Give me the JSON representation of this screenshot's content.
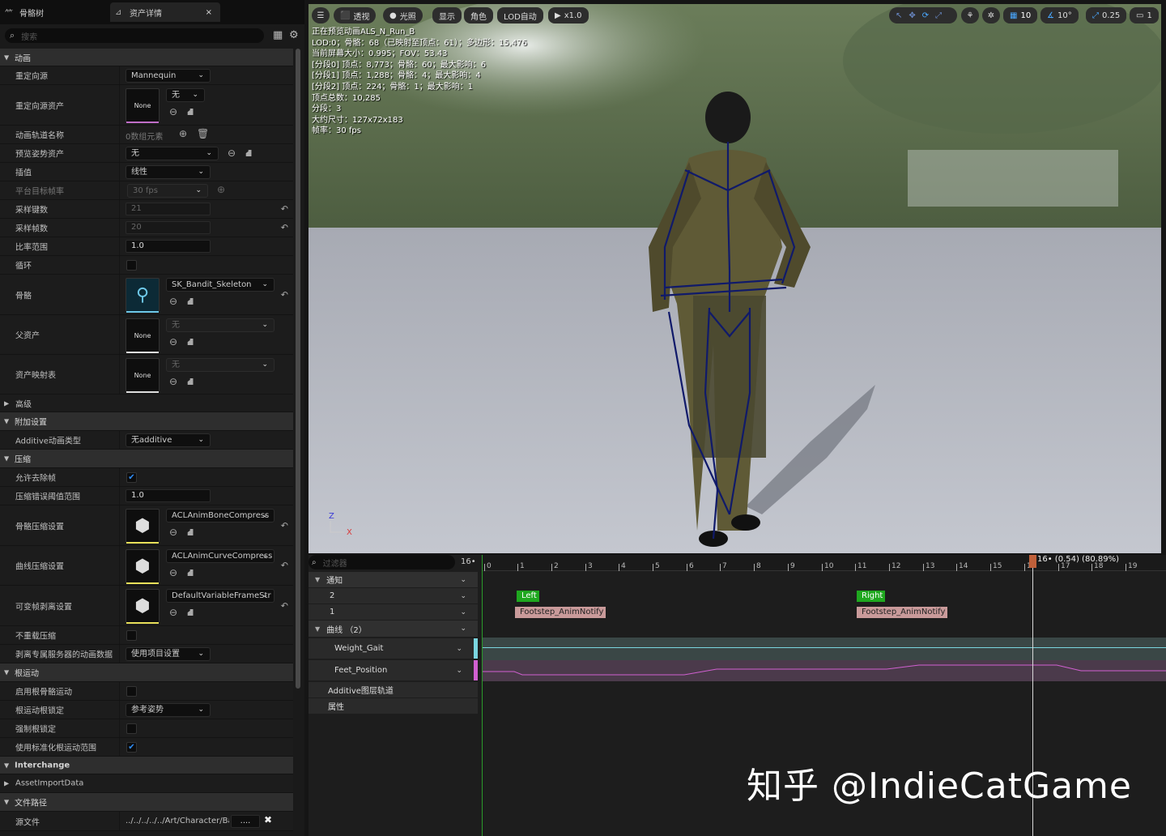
{
  "tabs": [
    {
      "label": "骨骼树"
    },
    {
      "label": "资产详情",
      "close": "×"
    }
  ],
  "search": {
    "placeholder": "搜索"
  },
  "sections": {
    "anim": "动画",
    "advanced": "高级",
    "additive": "附加设置",
    "compression": "压缩",
    "rootmotion": "根运动",
    "interchange": "Interchange",
    "assetimport": "AssetImportData",
    "filepath": "文件路径"
  },
  "props": {
    "retarget_source": {
      "label": "重定向源",
      "value": "Mannequin"
    },
    "retarget_asset": {
      "label": "重定向源资产",
      "thumb": "None",
      "value": "无"
    },
    "anim_track_names": {
      "label": "动画轨道名称",
      "value": "0数组元素"
    },
    "preview_pose": {
      "label": "预览姿势资产",
      "value": "无"
    },
    "interpolation": {
      "label": "插值",
      "value": "线性"
    },
    "platform_rate": {
      "label": "平台目标帧率",
      "value": "30 fps"
    },
    "sample_keys": {
      "label": "采样键数",
      "value": "21"
    },
    "sample_frames": {
      "label": "采样帧数",
      "value": "20"
    },
    "rate_scale": {
      "label": "比率范围",
      "value": "1.0"
    },
    "loop": {
      "label": "循环"
    },
    "skeleton": {
      "label": "骨骼",
      "value": "SK_Bandit_Skeleton"
    },
    "parent_asset": {
      "label": "父资产",
      "thumb": "None",
      "value": "无"
    },
    "asset_map": {
      "label": "资产映射表",
      "thumb": "None",
      "value": "无"
    },
    "additive_type": {
      "label": "Additive动画类型",
      "value": "无additive"
    },
    "allow_frame_strip": {
      "label": "允许去除帧"
    },
    "compress_error": {
      "label": "压缩错误阈值范围",
      "value": "1.0"
    },
    "bone_compress": {
      "label": "骨骼压缩设置",
      "value": "ACLAnimBoneCompress"
    },
    "curve_compress": {
      "label": "曲线压缩设置",
      "value": "ACLAnimCurveCompress"
    },
    "var_frame_strip": {
      "label": "可变帧剥离设置",
      "value": "DefaultVariableFrameStr"
    },
    "no_recompress": {
      "label": "不重载压缩"
    },
    "dedicated_server": {
      "label": "剥离专属服务器的动画数据",
      "value": "使用项目设置"
    },
    "enable_root": {
      "label": "启用根骨骼运动"
    },
    "root_lock": {
      "label": "根运动根锁定",
      "value": "参考姿势"
    },
    "force_root_lock": {
      "label": "强制根锁定"
    },
    "normalized_root": {
      "label": "使用标准化根运动范围"
    },
    "source_file": {
      "label": "源文件",
      "value": "../../../../../Art/Character/Ba",
      "btn": "...."
    }
  },
  "viewport": {
    "toolbar": {
      "menu": "☰",
      "perspective": "透视",
      "lit": "光照",
      "show": "显示",
      "character": "角色",
      "lod": "LOD自动",
      "play": "x1.0",
      "grid": "10",
      "angle": "10°",
      "scale": "0.25",
      "cam": "1"
    },
    "stats": [
      "正在预览动画ALS_N_Run_B",
      "LOD:0；骨骼：68（已映射至顶点：61）；多边形：15,476",
      "当前屏幕大小：0.995；FOV：53.43",
      "[分段0] 顶点：8,773；骨骼：60；最大影响：6",
      "[分段1] 顶点：1,288；骨骼：4；最大影响：4",
      "[分段2] 顶点：224；骨骼：1；最大影响：1",
      "顶点总数：10,285",
      "分段：3",
      "大约尺寸：127x72x183",
      "帧率：30 fps"
    ],
    "axis_z": "Z",
    "axis_x": "X"
  },
  "timeline": {
    "filter_placeholder": "过滤器",
    "frame_count": "16•",
    "tracks": {
      "notify": "通知",
      "n2": "2",
      "n1": "1",
      "curves": "曲线 （2）",
      "weight": "Weight_Gait",
      "feet": "Feet_Position",
      "additive": "Additive图层轨道",
      "attributes": "属性"
    },
    "ticks": [
      "0",
      "1",
      "2",
      "3",
      "4",
      "5",
      "6",
      "7",
      "8",
      "9",
      "10",
      "11",
      "12",
      "13",
      "14",
      "15",
      "16",
      "17",
      "18",
      "19"
    ],
    "playhead": "16• (0.54) (80.89%)",
    "notifies": {
      "left": "Left",
      "right": "Right",
      "footstep1": "Footstep_AnimNotify",
      "footstep2": "Footstep_AnimNotify"
    }
  },
  "watermark": "知乎 @IndieCatGame"
}
